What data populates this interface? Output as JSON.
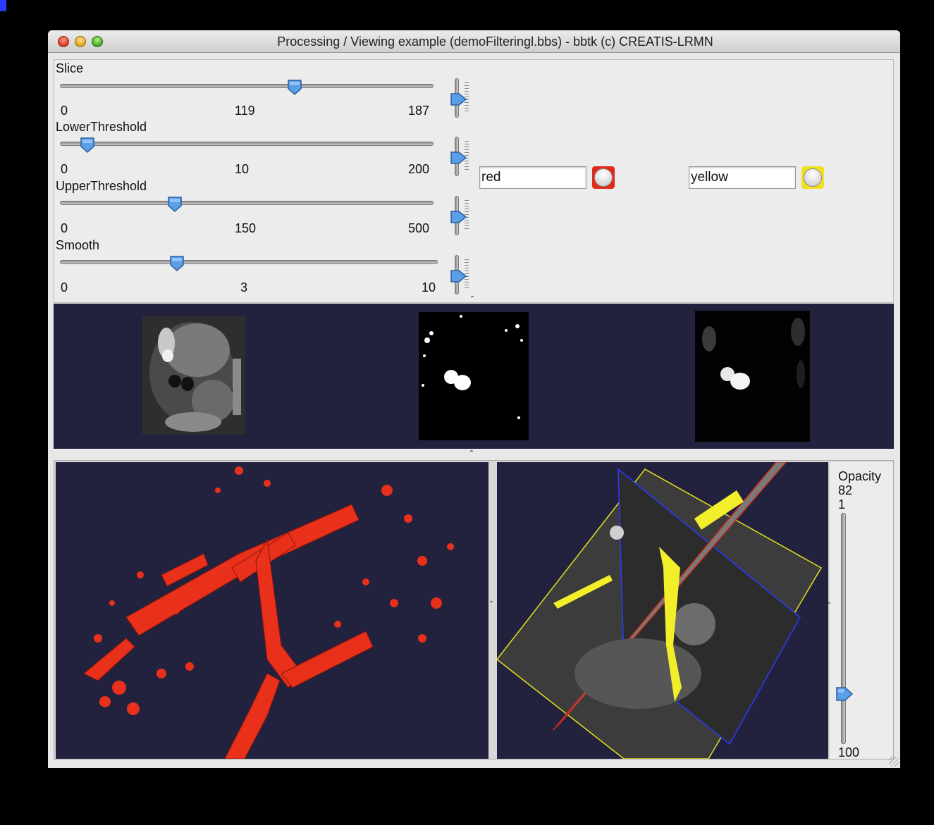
{
  "window": {
    "title": "Processing / Viewing example (demoFilteringl.bbs)  - bbtk (c) CREATIS-LRMN"
  },
  "sliders": [
    {
      "label": "Slice",
      "min": "0",
      "value": "119",
      "max": "187",
      "fraction": 0.636
    },
    {
      "label": "LowerThreshold",
      "min": "0",
      "value": "10",
      "max": "200",
      "fraction": 0.05
    },
    {
      "label": "UpperThreshold",
      "min": "0",
      "value": "150",
      "max": "500",
      "fraction": 0.3
    },
    {
      "label": "Smooth",
      "min": "0",
      "value": "3",
      "max": "10",
      "fraction": 0.3
    }
  ],
  "colors": [
    {
      "name": "red",
      "swatch": "#e02a1a"
    },
    {
      "name": "yellow",
      "swatch": "#f0e020"
    }
  ],
  "opacity": {
    "label": "Opacity",
    "value": "82",
    "min": "1",
    "max": "100",
    "fraction": 0.82
  },
  "theme": {
    "view_background": "#22223f",
    "surface_red": "#e8301a",
    "surface_yellow": "#f2ee2a"
  }
}
